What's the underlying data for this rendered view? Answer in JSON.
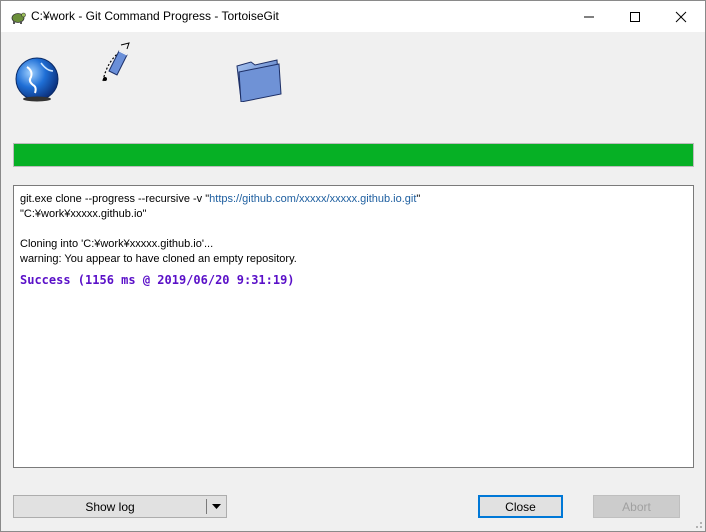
{
  "window": {
    "title": "C:¥work - Git Command Progress - TortoiseGit",
    "icons": {
      "app": "tortoisegit-icon",
      "minimize": "minimize-icon",
      "maximize": "maximize-icon",
      "close": "close-icon"
    }
  },
  "animation": {
    "icons": [
      "globe-icon",
      "flying-file-icon",
      "folder-icon"
    ]
  },
  "progress": {
    "value_percent": 100,
    "color": "#06b025"
  },
  "log": {
    "command_prefix": "git.exe clone --progress --recursive -v \"",
    "command_url": "https://github.com/xxxxx/xxxxx.github.io.git",
    "command_suffix": "\"",
    "target_path": "\"C:¥work¥xxxxx.github.io\"",
    "cloning_line": "Cloning into 'C:¥work¥xxxxx.github.io'...",
    "warning_line": "warning: You appear to have cloned an empty repository.",
    "success_line": "Success (1156 ms @ 2019/06/20 9:31:19)",
    "success_color": "#5a10c8",
    "url_color": "#1e5fa0"
  },
  "buttons": {
    "show_log": "Show log",
    "close": "Close",
    "abort": "Abort"
  }
}
